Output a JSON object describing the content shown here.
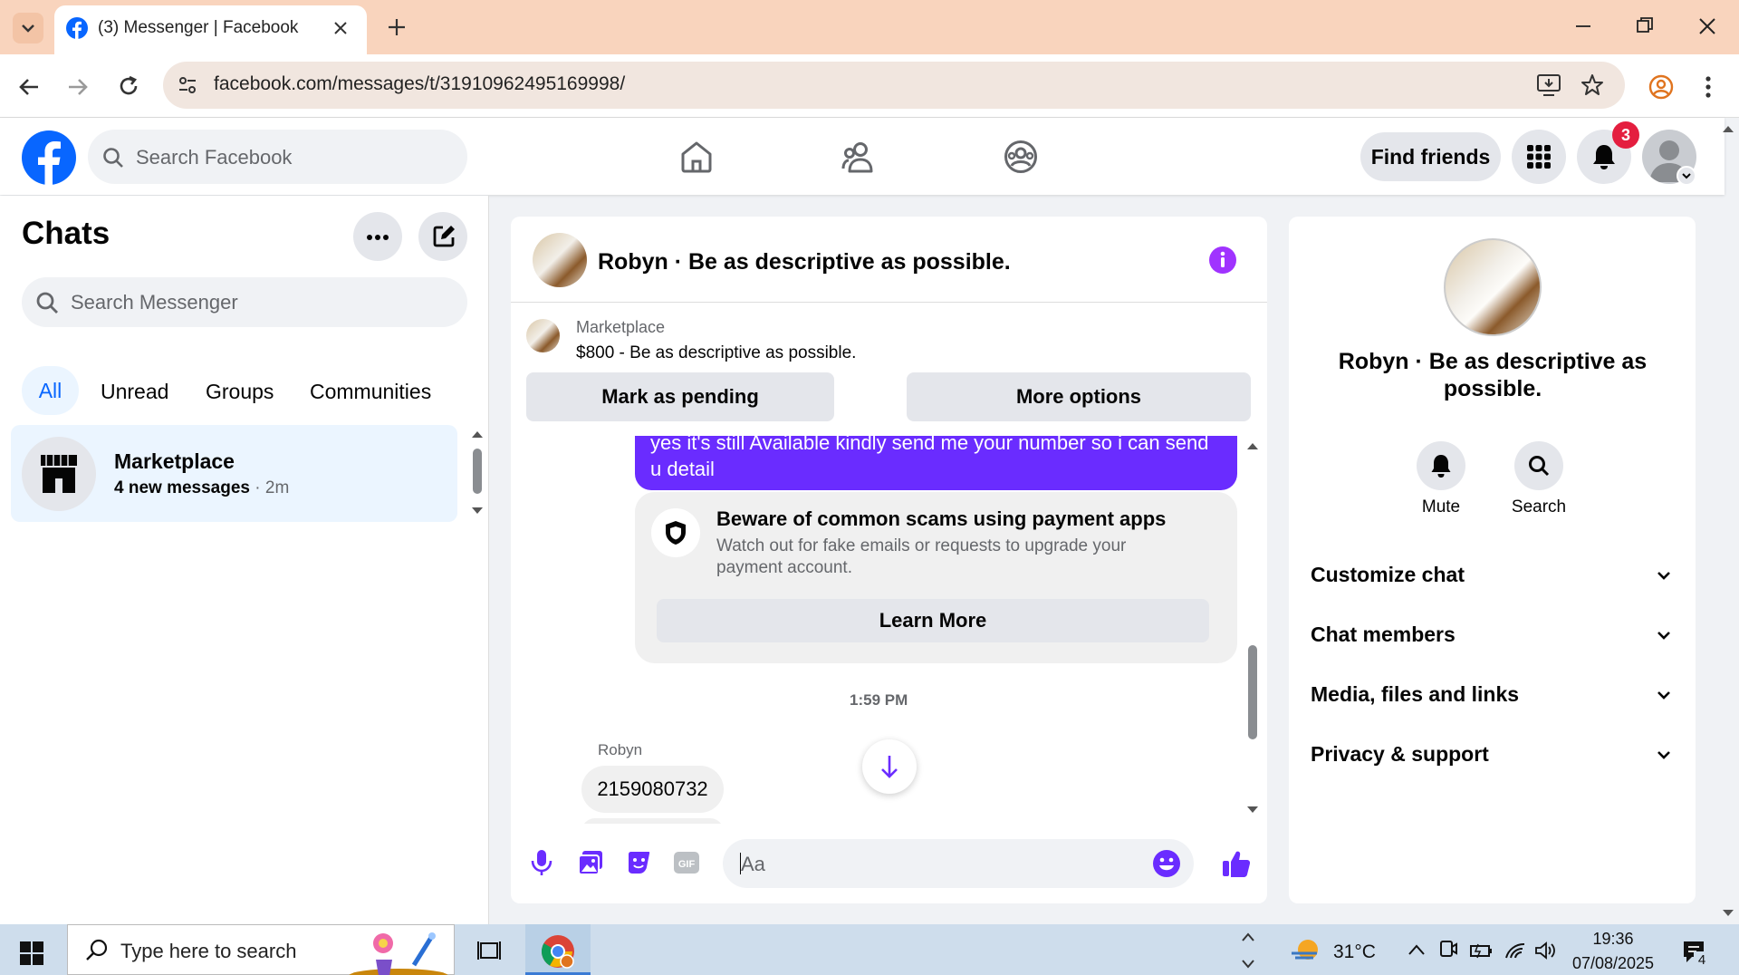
{
  "browser": {
    "tab_title": "(3) Messenger | Facebook",
    "url": "facebook.com/messages/t/31910962495169998/"
  },
  "facebook": {
    "search_placeholder": "Search Facebook",
    "find_friends": "Find friends",
    "notifications_count": "3"
  },
  "chats": {
    "title": "Chats",
    "search_placeholder": "Search Messenger",
    "filters": [
      "All",
      "Unread",
      "Groups",
      "Communities"
    ],
    "items": [
      {
        "name": "Marketplace",
        "preview": "4 new messages",
        "time": "· 2m"
      }
    ]
  },
  "conversation": {
    "title": "Robyn · Be as descriptive as possible.",
    "listing": {
      "label": "Marketplace",
      "detail": "$800 - Be as descriptive as possible."
    },
    "mark_pending": "Mark as pending",
    "more_options": "More options",
    "sent_message": "yes it's still Available kindly send me your number so i can send u detail",
    "warning": {
      "title": "Beware of common scams using payment apps",
      "body": "Watch out for fake emails or requests to upgrade your payment account.",
      "button": "Learn More"
    },
    "timestamp": "1:59 PM",
    "sender": "Robyn",
    "received_message": "2159080732",
    "composer_placeholder": "Aa"
  },
  "details": {
    "name": "Robyn · Be as descriptive as possible.",
    "actions": [
      "Mute",
      "Search"
    ],
    "sections": [
      "Customize chat",
      "Chat members",
      "Media, files and links",
      "Privacy & support"
    ]
  },
  "taskbar": {
    "search_placeholder": "Type here to search",
    "weather": "31°C",
    "time": "19:36",
    "date": "07/08/2025",
    "notification_count": "4"
  },
  "colors": {
    "fb_blue": "#0866ff",
    "message_purple": "#6a2cff",
    "accent_purple": "#a033ff",
    "badge_red": "#e41e3f"
  }
}
